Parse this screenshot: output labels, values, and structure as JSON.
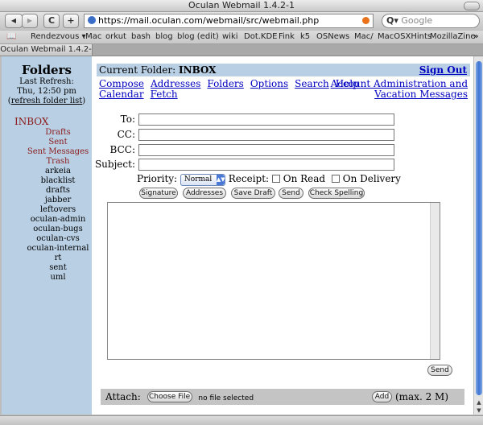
{
  "window": {
    "title": "Oculan Webmail 1.4.2-1"
  },
  "toolbar": {
    "back": "◀",
    "forward": "▶",
    "reload": "C",
    "add": "+",
    "url": "https://mail.oculan.com/webmail/src/webmail.php",
    "search_placeholder": "Google",
    "search_icon": "Q▾"
  },
  "bookmarks": {
    "book_icon": "📖",
    "items": [
      "Rendezvous ▾",
      ".Mac",
      "orkut",
      "bash",
      "blog",
      "blog (edit)",
      "wiki",
      "Dot.KDE",
      "Fink",
      "k5",
      "OSNews",
      "Mac/",
      "MacOSXHints",
      "MozillaZine"
    ],
    "overflow": "»"
  },
  "tab": {
    "label": "Oculan Webmail 1.4.2-1"
  },
  "sidebar": {
    "title": "Folders",
    "last_refresh_label": "Last Refresh:",
    "last_refresh_time": "Thu, 12:50 pm",
    "refresh_link": "refresh folder list",
    "folders_red": [
      "INBOX",
      "Drafts",
      "Sent",
      "Sent Messages",
      "Trash"
    ],
    "folders_black": [
      "arkeia",
      "blacklist",
      "drafts",
      "jabber",
      "leftovers",
      "oculan-admin",
      "oculan-bugs",
      "oculan-cvs",
      "oculan-internal",
      "rt",
      "sent",
      "uml"
    ]
  },
  "header": {
    "current_folder_label": "Current Folder:",
    "current_folder": "INBOX",
    "sign_out": "Sign Out"
  },
  "nav": {
    "row1": [
      "Compose",
      "Addresses",
      "Folders",
      "Options",
      "Search",
      "Help"
    ],
    "row2": [
      "Calendar",
      "Fetch"
    ],
    "right1": "Account Administration and",
    "right2": "Vacation Messages"
  },
  "compose": {
    "to_label": "To:",
    "cc_label": "CC:",
    "bcc_label": "BCC:",
    "subject_label": "Subject:",
    "priority_label": "Priority:",
    "priority_value": "Normal",
    "receipt_label": "Receipt:",
    "on_read": "On Read",
    "on_delivery": "On Delivery",
    "buttons": [
      "Signature",
      "Addresses",
      "Save Draft",
      "Send",
      "Check Spelling"
    ],
    "send_bottom": "Send"
  },
  "attach": {
    "label": "Attach:",
    "choose_file": "Choose File",
    "no_file": "no file selected",
    "add": "Add",
    "max": "(max. 2 M)"
  }
}
